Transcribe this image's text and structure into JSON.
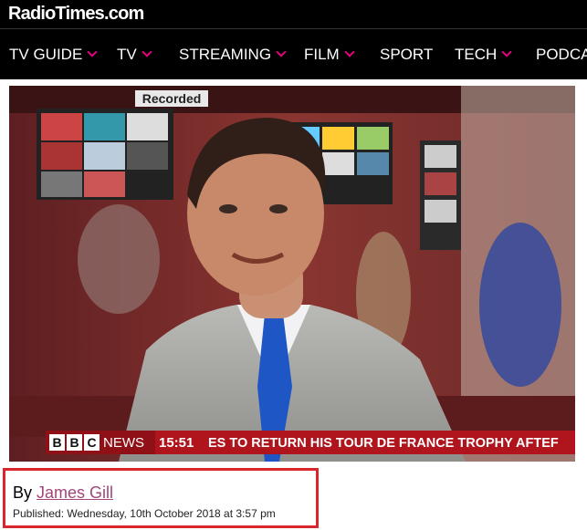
{
  "site": {
    "logo": "RadioTimes.com"
  },
  "nav": {
    "items": [
      {
        "label": "TV GUIDE",
        "has_dropdown": true
      },
      {
        "label": "TV",
        "has_dropdown": true
      },
      {
        "label": "STREAMING",
        "has_dropdown": true
      },
      {
        "label": "FILM",
        "has_dropdown": true
      },
      {
        "label": "SPORT",
        "has_dropdown": false
      },
      {
        "label": "TECH",
        "has_dropdown": true
      },
      {
        "label": "PODCA",
        "has_dropdown": false
      }
    ]
  },
  "video": {
    "badge": "Recorded",
    "ticker": {
      "bbc_letters": [
        "B",
        "B",
        "C"
      ],
      "channel": "NEWS",
      "time": "15:51",
      "headline": "ES TO RETURN HIS TOUR DE FRANCE TROPHY AFTEF"
    }
  },
  "article": {
    "by_label": "By",
    "author": "James Gill",
    "published": "Published: Wednesday, 10th October 2018 at 3:57 pm"
  },
  "colors": {
    "accent": "#e6007e",
    "highlight_border": "#d9262c",
    "author_link": "#a3457a",
    "ticker_red": "#b0141c"
  }
}
